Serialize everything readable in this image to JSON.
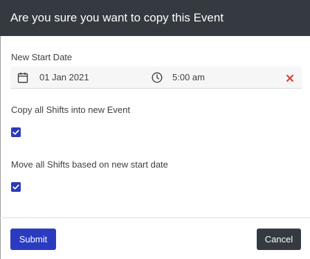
{
  "dialog": {
    "title": "Are you sure you want to copy this Event"
  },
  "start_date": {
    "label": "New Start Date",
    "date_value": "01 Jan 2021",
    "time_value": "5:00 am",
    "icons": {
      "calendar": "calendar-icon",
      "clock": "clock-icon",
      "clear": "close-icon"
    }
  },
  "options": [
    {
      "label": "Copy all Shifts into new Event",
      "checked": true
    },
    {
      "label": "Move all Shifts based on new start date",
      "checked": true
    }
  ],
  "footer": {
    "submit_label": "Submit",
    "cancel_label": "Cancel"
  },
  "colors": {
    "header_bg": "#343a40",
    "accent": "#2b3bc0",
    "clear_icon": "#e03c3c"
  }
}
